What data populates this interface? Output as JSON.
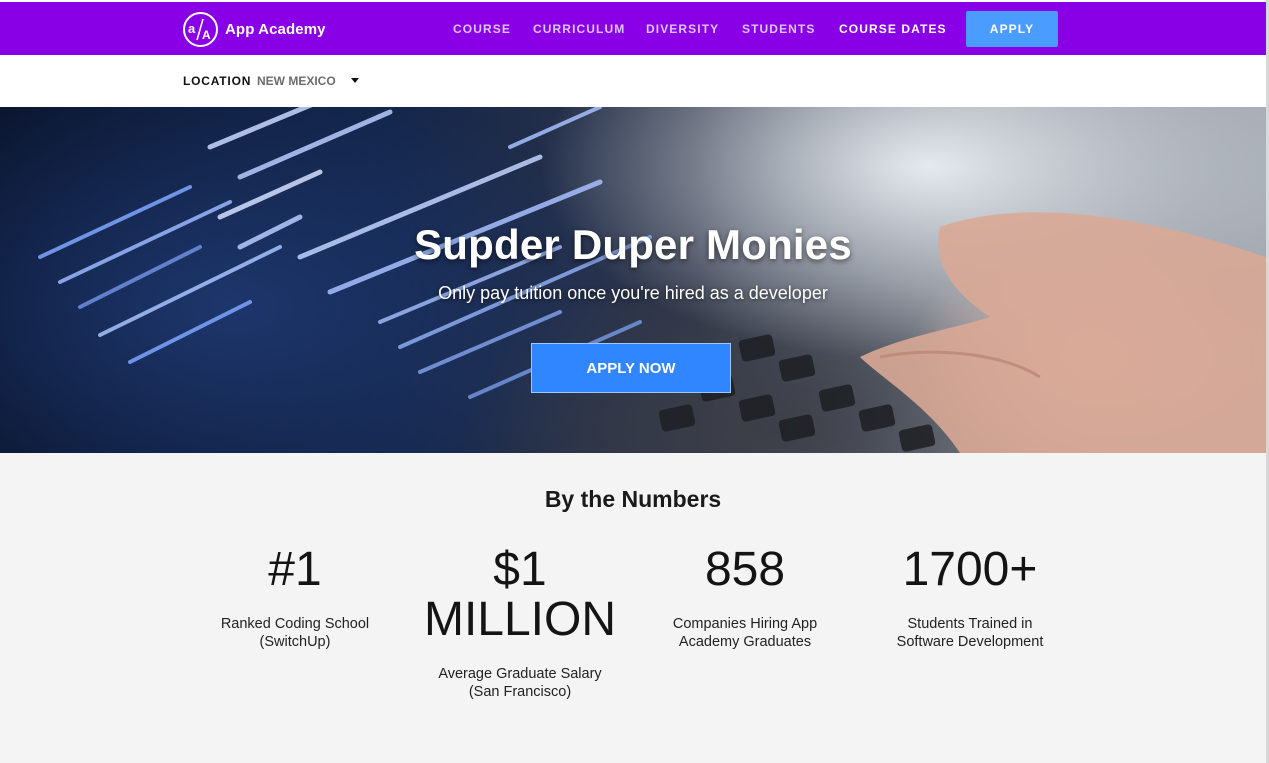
{
  "nav": {
    "brand": "App Academy",
    "links": [
      "COURSE",
      "CURRICULUM",
      "DIVERSITY",
      "STUDENTS",
      "COURSE DATES"
    ],
    "active_link": "COURSE DATES",
    "apply_label": "APPLY",
    "accent_color": "#8a00e6",
    "logo_icon": "app-academy-logo-icon"
  },
  "location": {
    "label": "LOCATION",
    "value": "NEW MEXICO",
    "caret_icon": "caret-down-icon"
  },
  "hero": {
    "title": "Supder Duper Monies",
    "subtitle": "Only pay tuition once you're hired as a developer",
    "cta_label": "APPLY NOW",
    "cta_color": "#2f86ff"
  },
  "numbers": {
    "title": "By the Numbers",
    "stats": [
      {
        "value": "#1",
        "desc_line1": "Ranked Coding School",
        "desc_line2": "(SwitchUp)"
      },
      {
        "value_line1": "$1",
        "value_line2": "MILLION",
        "desc_line1": "Average Graduate Salary",
        "desc_line2": "(San Francisco)"
      },
      {
        "value": "858",
        "desc_line1": "Companies Hiring App",
        "desc_line2": "Academy Graduates"
      },
      {
        "value": "1700+",
        "desc_line1": "Students Trained in",
        "desc_line2": "Software Development"
      }
    ]
  }
}
